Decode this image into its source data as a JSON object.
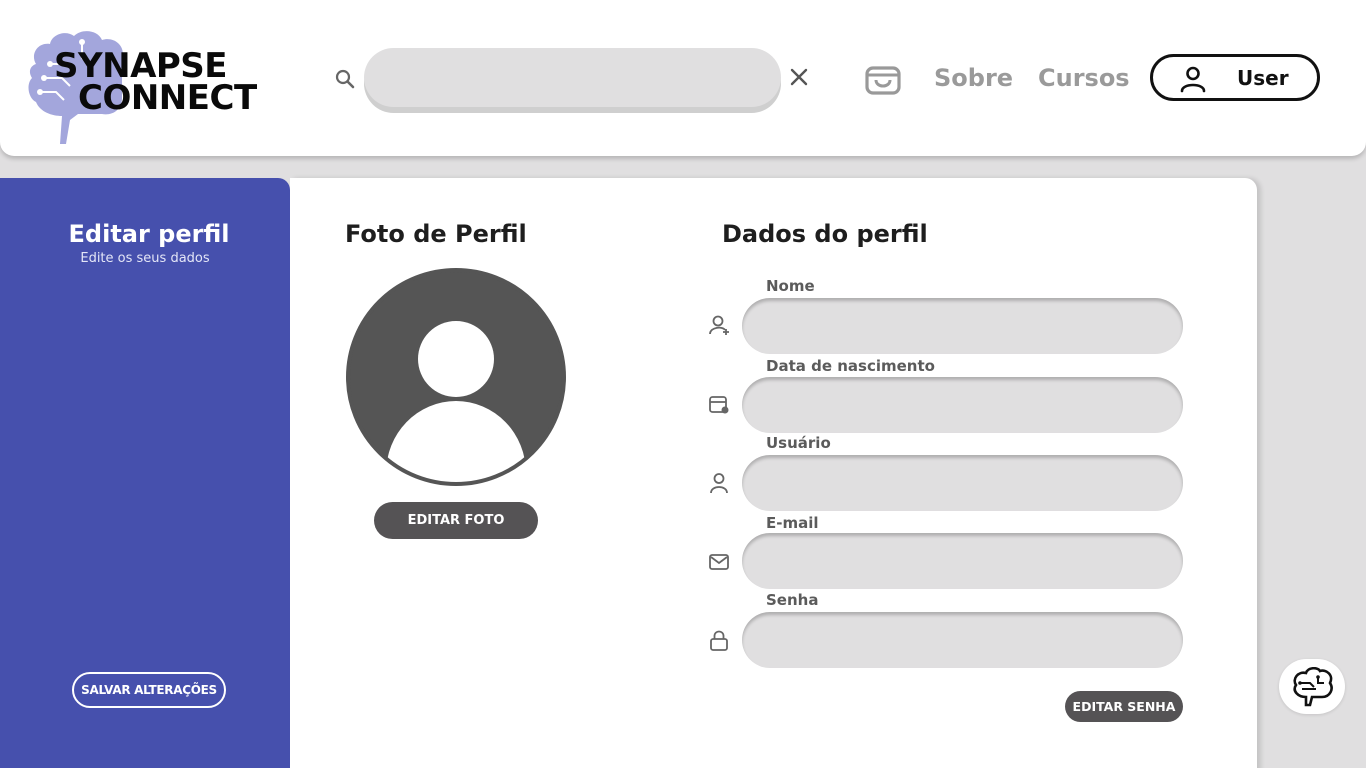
{
  "window": {
    "close_icon": "close-icon"
  },
  "header": {
    "logo": {
      "line1": "SYNAPSE",
      "line2": "CONNECT",
      "icon": "brain-circuit-icon",
      "color": "#a3a6dc"
    },
    "search": {
      "placeholder": "",
      "value": ""
    },
    "nav": {
      "sobre": "Sobre",
      "cursos": "Cursos"
    },
    "user_button": {
      "label": "User"
    }
  },
  "sidebar": {
    "title": "Editar perfil",
    "subtitle": "Edite os seus dados",
    "save_label": "SALVAR ALTERAÇÕES",
    "color": "#4650ad"
  },
  "main": {
    "photo_section": {
      "title": "Foto de Perfil",
      "edit_photo_label": "EDITAR FOTO"
    },
    "data_section": {
      "title": "Dados do perfil",
      "fields": [
        {
          "label": "Nome",
          "icon": "user-add-icon",
          "value": ""
        },
        {
          "label": "Data de nascimento",
          "icon": "calendar-user-icon",
          "value": ""
        },
        {
          "label": "Usuário",
          "icon": "user-icon",
          "value": ""
        },
        {
          "label": "E-mail",
          "icon": "mail-icon",
          "value": ""
        },
        {
          "label": "Senha",
          "icon": "lock-icon",
          "value": ""
        }
      ],
      "edit_password_label": "EDITAR SENHA"
    }
  },
  "chat": {
    "icon": "brain-chat-icon"
  }
}
